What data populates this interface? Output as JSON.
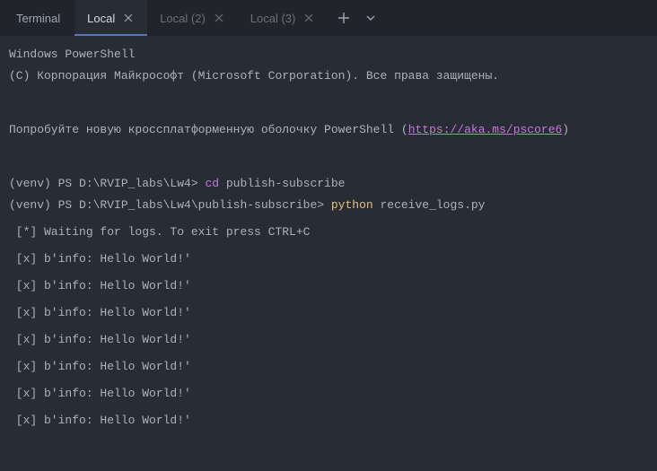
{
  "panel": {
    "title": "Terminal"
  },
  "tabs": [
    {
      "label": "Local",
      "active": true
    },
    {
      "label": "Local (2)",
      "active": false
    },
    {
      "label": "Local (3)",
      "active": false
    }
  ],
  "shell": {
    "header1": "Windows PowerShell",
    "header2": "(C) Корпорация Майкрософт (Microsoft Corporation). Все права защищены.",
    "tryline_prefix": "Попробуйте новую кроссплатформенную оболочку PowerShell (",
    "tryline_link": "https://aka.ms/pscore6",
    "tryline_suffix": ")",
    "prompt1_prefix": "(venv) PS D:\\RVIP_labs\\Lw4> ",
    "prompt1_cmd_kw": "cd ",
    "prompt1_cmd_rest": "publish-subscribe",
    "prompt2_prefix": "(venv) PS D:\\RVIP_labs\\Lw4\\publish-subscribe> ",
    "prompt2_cmd_kw": "python ",
    "prompt2_script": "receive_logs.py",
    "waiting": " [*] Waiting for logs. To exit press CTRL+C",
    "log1": " [x] b'info: Hello World!'",
    "log2": " [x] b'info: Hello World!'",
    "log3": " [x] b'info: Hello World!'",
    "log4": " [x] b'info: Hello World!'",
    "log5": " [x] b'info: Hello World!'",
    "log6": " [x] b'info: Hello World!'",
    "log7": " [x] b'info: Hello World!'"
  }
}
